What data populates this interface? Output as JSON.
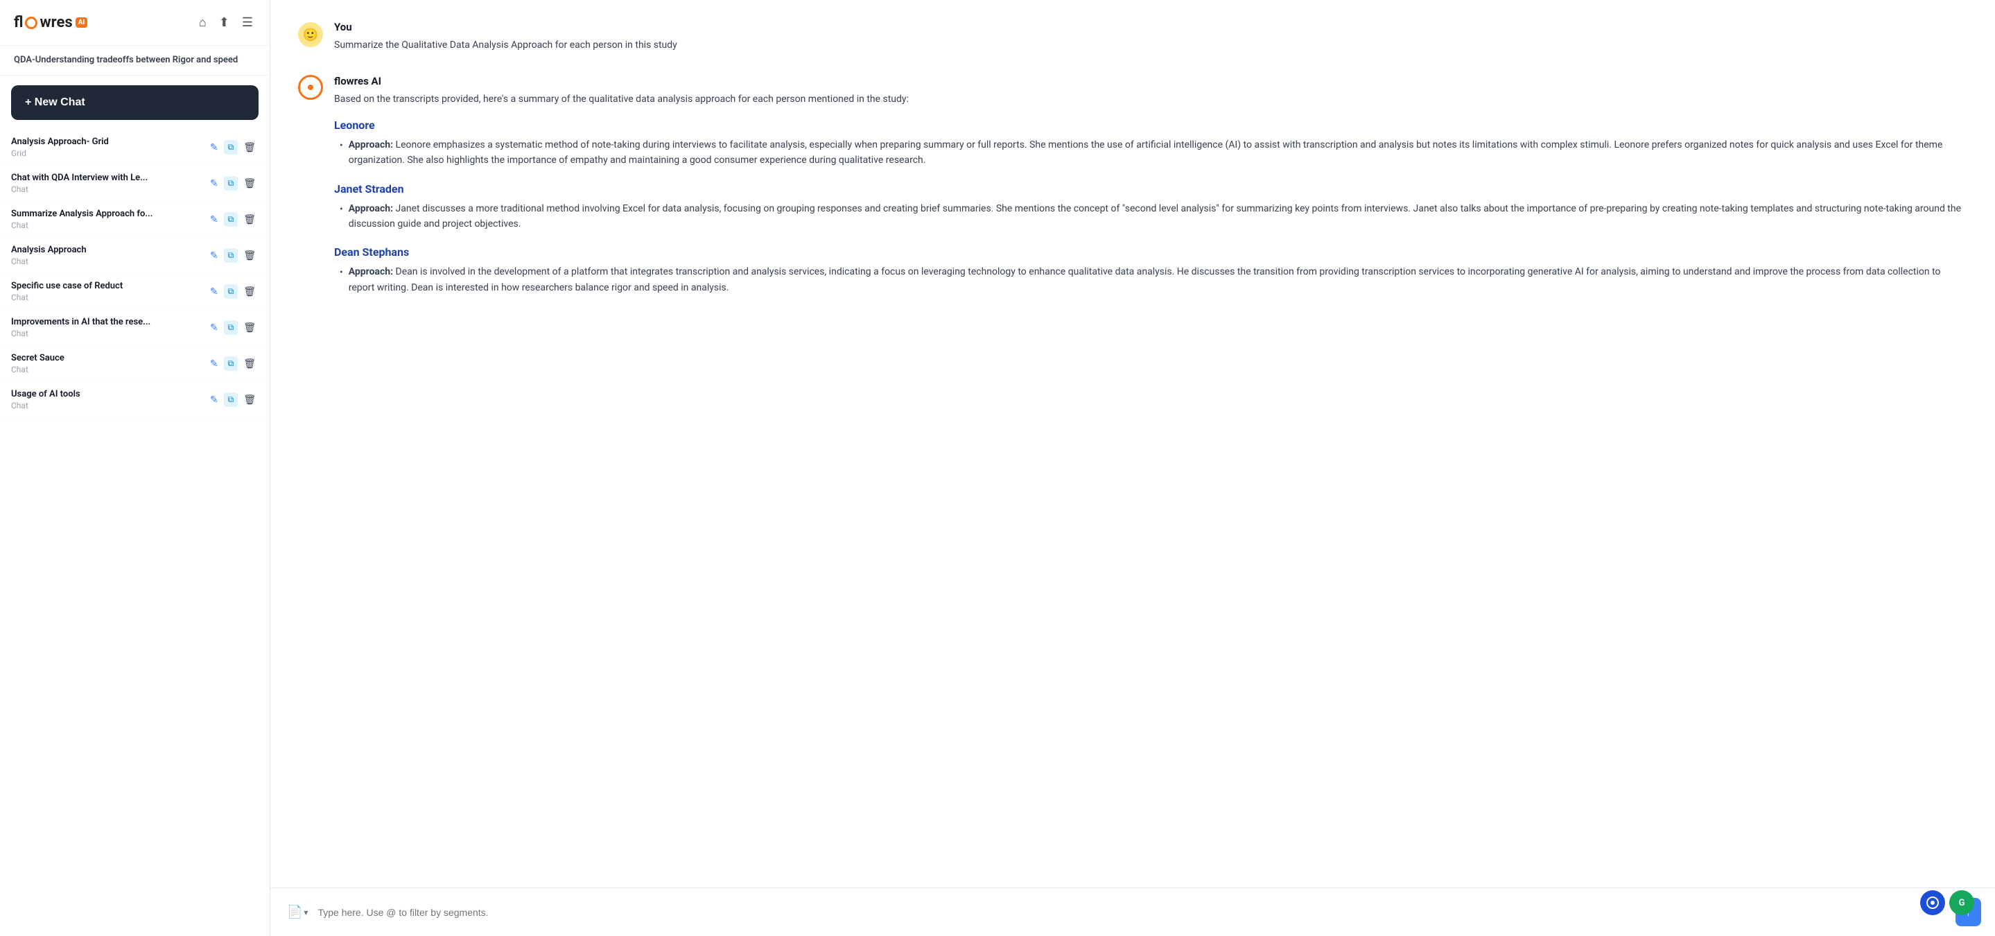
{
  "sidebar": {
    "logo": {
      "text": "flowres",
      "badge": "AI"
    },
    "project_title": "QDA-Understanding tradeoffs between Rigor and speed",
    "new_chat_label": "+ New Chat",
    "chat_items": [
      {
        "title": "Analysis Approach- Grid",
        "subtitle": "Grid"
      },
      {
        "title": "Chat with QDA Interview with Le...",
        "subtitle": "Chat"
      },
      {
        "title": "Summarize Analysis Approach fo...",
        "subtitle": "Chat"
      },
      {
        "title": "Analysis Approach",
        "subtitle": "Chat"
      },
      {
        "title": "Specific use case of Reduct",
        "subtitle": "Chat"
      },
      {
        "title": "Improvements in AI that the rese...",
        "subtitle": "Chat"
      },
      {
        "title": "Secret Sauce",
        "subtitle": "Chat"
      },
      {
        "title": "Usage of AI tools",
        "subtitle": "Chat"
      }
    ]
  },
  "chat": {
    "user_message": {
      "sender": "You",
      "text": "Summarize the Qualitative Data Analysis Approach for each person in this study"
    },
    "ai_message": {
      "sender": "flowres AI",
      "intro": "Based on the transcripts provided, here's a summary of the qualitative data analysis approach for each person mentioned in the study:",
      "persons": [
        {
          "name": "Leonore",
          "approach_text": "Leonore emphasizes a systematic method of note-taking during interviews to facilitate analysis, especially when preparing summary or full reports. She mentions the use of artificial intelligence (AI) to assist with transcription and analysis but notes its limitations with complex stimuli. Leonore prefers organized notes for quick analysis and uses Excel for theme organization. She also highlights the importance of empathy and maintaining a good consumer experience during qualitative research."
        },
        {
          "name": "Janet Straden",
          "approach_text": "Janet discusses a more traditional method involving Excel for data analysis, focusing on grouping responses and creating brief summaries. She mentions the concept of \"second level analysis\" for summarizing key points from interviews. Janet also talks about the importance of pre-preparing by creating note-taking templates and structuring note-taking around the discussion guide and project objectives."
        },
        {
          "name": "Dean Stephans",
          "approach_text": "Dean is involved in the development of a platform that integrates transcription and analysis services, indicating a focus on leveraging technology to enhance qualitative data analysis. He discusses the transition from providing transcription services to incorporating generative AI for analysis, aiming to understand and improve the process from data collection to report writing. Dean is interested in how researchers balance rigor and speed in analysis."
        }
      ]
    }
  },
  "input": {
    "placeholder": "Type here. Use @ to filter by segments."
  },
  "icons": {
    "home": "⌂",
    "upload": "↑",
    "menu": "≡",
    "edit": "✎",
    "copy": "⧉",
    "delete": "🗑",
    "send": "↑",
    "doc": "📄",
    "chevron_down": "▾"
  }
}
